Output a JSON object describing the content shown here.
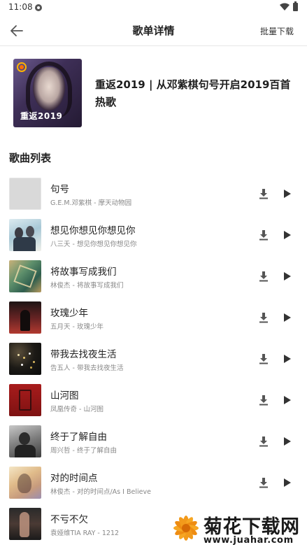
{
  "status_bar": {
    "time": "11:08"
  },
  "appbar": {
    "back_icon": "arrow-left-icon",
    "title": "歌单详情",
    "batch_download_label": "批量下载"
  },
  "playlist": {
    "cover_badge": "重返2019",
    "name": "重返2019 | 从邓紫棋句号开启2019百首热歌"
  },
  "section_title": "歌曲列表",
  "songs": [
    {
      "title": "句号",
      "subtitle": "G.E.M.邓紫棋 - 摩天动物园"
    },
    {
      "title": "想见你想见你想见你",
      "subtitle": "八三夭 - 想见你想见你想见你"
    },
    {
      "title": "将故事写成我们",
      "subtitle": "林俊杰 - 将故事写成我们"
    },
    {
      "title": "玫瑰少年",
      "subtitle": "五月天 - 玫瑰少年"
    },
    {
      "title": "带我去找夜生活",
      "subtitle": "告五人 - 带我去找夜生活"
    },
    {
      "title": "山河图",
      "subtitle": "凤凰传奇 - 山河图"
    },
    {
      "title": "终于了解自由",
      "subtitle": "周兴哲 - 终于了解自由"
    },
    {
      "title": "对的时间点",
      "subtitle": "林俊杰 - 对的时间点/As I Believe"
    },
    {
      "title": "不亏不欠",
      "subtitle": "袁娅维TIA RAY - 1212"
    }
  ],
  "row_icons": {
    "download": "download-icon",
    "play": "play-icon"
  },
  "watermark": {
    "text": "菊花下载网",
    "url": "www.juahar.com"
  },
  "colors": {
    "accent_text": "#222222",
    "subtitle_text": "#888888",
    "divider": "#e6e6e6"
  }
}
